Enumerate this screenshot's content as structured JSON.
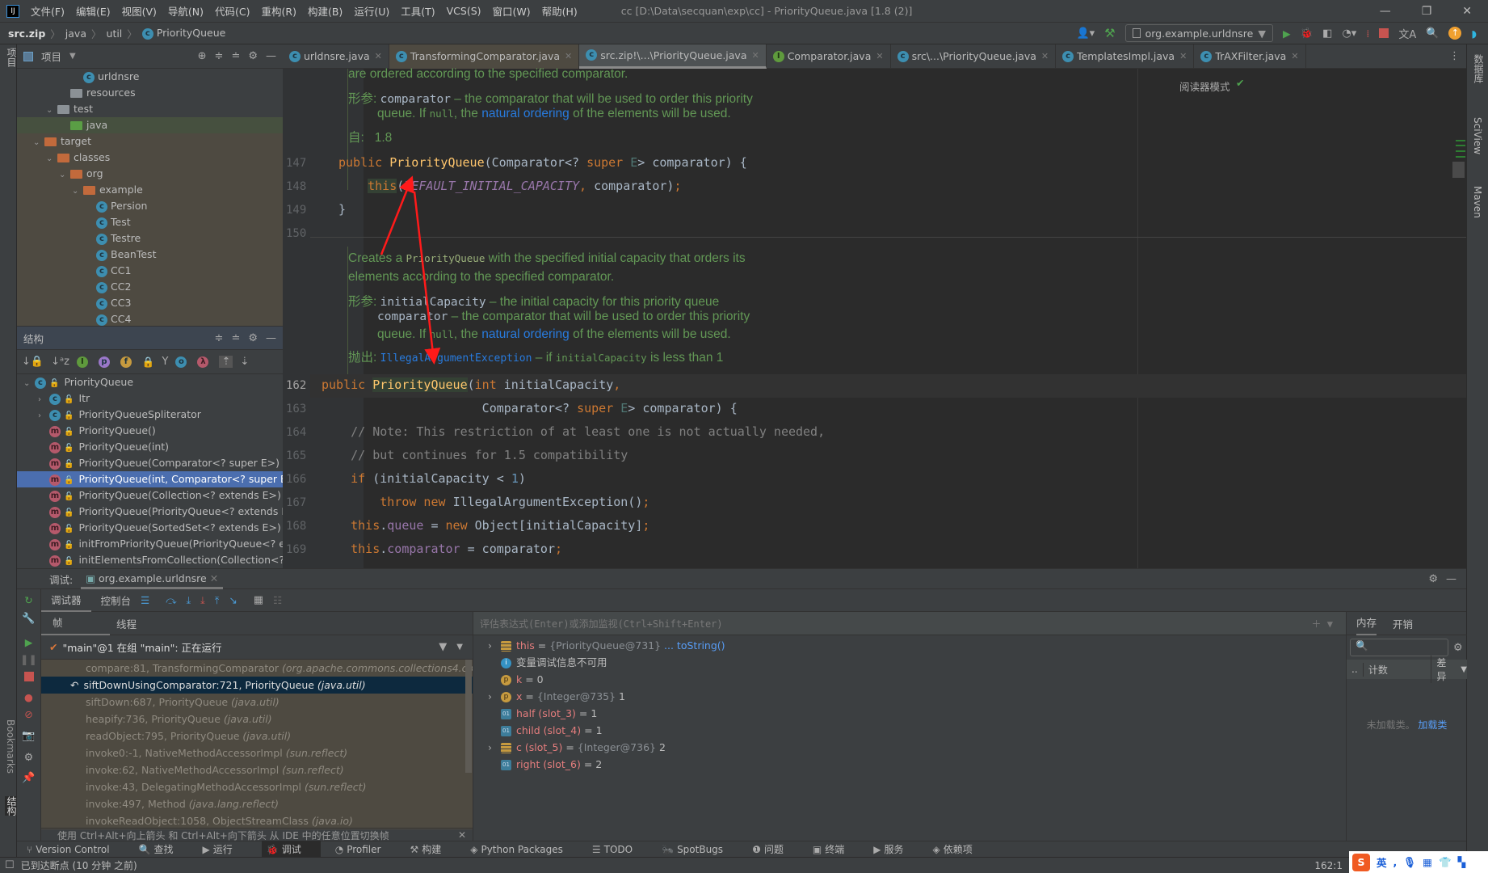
{
  "titlebar": {
    "menu": [
      "文件(F)",
      "编辑(E)",
      "视图(V)",
      "导航(N)",
      "代码(C)",
      "重构(R)",
      "构建(B)",
      "运行(U)",
      "工具(T)",
      "VCS(S)",
      "窗口(W)",
      "帮助(H)"
    ],
    "title": "cc [D:\\Data\\secquan\\exp\\cc] - PriorityQueue.java [1.8 (2)]"
  },
  "breadcrumb": [
    "src.zip",
    "java",
    "util",
    "PriorityQueue"
  ],
  "run_config": "org.example.urldnsre",
  "project": {
    "title": "项目",
    "items": [
      {
        "label": "urldnsre",
        "indent": 5,
        "icon": "class-run"
      },
      {
        "label": "resources",
        "indent": 4,
        "icon": "folder-resources"
      },
      {
        "label": "test",
        "indent": 3,
        "icon": "folder-grey",
        "open": true
      },
      {
        "label": "java",
        "indent": 4,
        "icon": "folder-green"
      },
      {
        "label": "target",
        "indent": 2,
        "icon": "folder-orange",
        "open": true
      },
      {
        "label": "classes",
        "indent": 3,
        "icon": "folder-orange",
        "open": true
      },
      {
        "label": "org",
        "indent": 4,
        "icon": "folder-orange",
        "open": true
      },
      {
        "label": "example",
        "indent": 5,
        "icon": "folder-orange",
        "open": true
      },
      {
        "label": "Persion",
        "indent": 6,
        "icon": "class"
      },
      {
        "label": "Test",
        "indent": 6,
        "icon": "class"
      },
      {
        "label": "Testre",
        "indent": 6,
        "icon": "class"
      },
      {
        "label": "BeanTest",
        "indent": 6,
        "icon": "class-run"
      },
      {
        "label": "CC1",
        "indent": 6,
        "icon": "class-run"
      },
      {
        "label": "CC2",
        "indent": 6,
        "icon": "class-run"
      },
      {
        "label": "CC3",
        "indent": 6,
        "icon": "class-run"
      },
      {
        "label": "CC4",
        "indent": 6,
        "icon": "class-run"
      }
    ]
  },
  "structure": {
    "title": "结构",
    "items": [
      {
        "label": "PriorityQueue",
        "icon": "c",
        "indent": 0,
        "chev": "v"
      },
      {
        "label": "Itr",
        "icon": "c",
        "indent": 1,
        "chev": ">"
      },
      {
        "label": "PriorityQueueSpliterator",
        "icon": "c",
        "indent": 1,
        "chev": ">"
      },
      {
        "label": "PriorityQueue()",
        "icon": "m",
        "indent": 1
      },
      {
        "label": "PriorityQueue(int)",
        "icon": "m",
        "indent": 1
      },
      {
        "label": "PriorityQueue(Comparator<? super E>)",
        "icon": "m",
        "indent": 1
      },
      {
        "label": "PriorityQueue(int, Comparator<? super E>)",
        "icon": "m",
        "indent": 1,
        "selected": true
      },
      {
        "label": "PriorityQueue(Collection<? extends E>)",
        "icon": "m",
        "indent": 1
      },
      {
        "label": "PriorityQueue(PriorityQueue<? extends E>)",
        "icon": "m",
        "indent": 1
      },
      {
        "label": "PriorityQueue(SortedSet<? extends E>)",
        "icon": "m",
        "indent": 1
      },
      {
        "label": "initFromPriorityQueue(PriorityQueue<? extends E>)",
        "icon": "m",
        "indent": 1,
        "private": true
      },
      {
        "label": "initElementsFromCollection(Collection<? extends E>)",
        "icon": "m",
        "indent": 1,
        "private": true
      }
    ]
  },
  "tabs": [
    {
      "label": "urldnsre.java",
      "icon": "c"
    },
    {
      "label": "TransformingComparator.java",
      "icon": "c"
    },
    {
      "label": "src.zip!\\...\\PriorityQueue.java",
      "icon": "c",
      "active": true
    },
    {
      "label": "Comparator.java",
      "icon": "i"
    },
    {
      "label": "src\\...\\PriorityQueue.java",
      "icon": "c"
    },
    {
      "label": "TemplatesImpl.java",
      "icon": "c"
    },
    {
      "label": "TrAXFilter.java",
      "icon": "c"
    }
  ],
  "reader_mode": "阅读器模式",
  "doc1": {
    "line0": "are ordered according to the specified comparator.",
    "param_label": "形参:",
    "param": "comparator",
    "param_desc": " – the comparator that will be used to order this priority",
    "line2a": "queue. If ",
    "null": "null",
    "line2b": ", the ",
    "link": "natural ordering",
    "line2c": " of the elements will be used.",
    "since_label": "自:",
    "since": "1.8"
  },
  "doc2": {
    "l1a": "Creates a ",
    "l1m": "PriorityQueue",
    "l1b": " with the specified initial capacity that orders its",
    "l2": "elements according to the specified comparator.",
    "param_label": "形参:",
    "p1": "initialCapacity",
    "p1d": " – the initial capacity for this priority queue",
    "p2": "comparator",
    "p2d": " – the comparator that will be used to order this priority",
    "l5a": "queue. If ",
    "null": "null",
    "l5b": ", the ",
    "link": "natural ordering",
    "l5c": " of the elements will be used.",
    "throws_label": "抛出:",
    "exc": "IllegalArgumentException",
    "td": " – if ",
    "tm": "initialCapacity",
    "te": " is less than 1"
  },
  "line_numbers": {
    "a": [
      "147",
      "148",
      "149",
      "150"
    ],
    "b": [
      "162",
      "163",
      "164",
      "165",
      "166",
      "167",
      "168",
      "169"
    ]
  },
  "debug": {
    "label": "调试:",
    "session": "org.example.urldnsre",
    "tab_debugger": "调试器",
    "tab_console": "控制台",
    "tab_frames": "帧",
    "tab_threads": "线程",
    "thread": "\"main\"@1 在组 \"main\": 正在运行",
    "frames": [
      {
        "m": "compare:81, TransformingComparator ",
        "p": "(org.apache.commons.collections4.comparators)"
      },
      {
        "m": "siftDownUsingComparator:721, PriorityQueue ",
        "p": "(java.util)",
        "current": true
      },
      {
        "m": "siftDown:687, PriorityQueue ",
        "p": "(java.util)"
      },
      {
        "m": "heapify:736, PriorityQueue ",
        "p": "(java.util)"
      },
      {
        "m": "readObject:795, PriorityQueue ",
        "p": "(java.util)"
      },
      {
        "m": "invoke0:-1, NativeMethodAccessorImpl ",
        "p": "(sun.reflect)"
      },
      {
        "m": "invoke:62, NativeMethodAccessorImpl ",
        "p": "(sun.reflect)"
      },
      {
        "m": "invoke:43, DelegatingMethodAccessorImpl ",
        "p": "(sun.reflect)"
      },
      {
        "m": "invoke:497, Method ",
        "p": "(java.lang.reflect)"
      },
      {
        "m": "invokeReadObject:1058, ObjectStreamClass ",
        "p": "(java.io)"
      }
    ],
    "hint": "使用 Ctrl+Alt+向上箭头 和 Ctrl+Alt+向下箭头 从 IDE 中的任意位置切换帧",
    "eval_placeholder": "评估表达式(Enter)或添加监视(Ctrl+Shift+Enter)",
    "vars": [
      {
        "name": "this",
        "eq": " = ",
        "type": "{PriorityQueue@731}",
        "extra": " ... toString()",
        "icon": "field",
        "exp": true
      },
      {
        "info": "变量调试信息不可用"
      },
      {
        "name": "k",
        "eq": " = ",
        "val": "0",
        "icon": "p"
      },
      {
        "name": "x",
        "eq": " = ",
        "type": "{Integer@735} ",
        "val": "1",
        "icon": "p",
        "exp": true
      },
      {
        "name": "half (slot_3)",
        "eq": " = ",
        "val": "1",
        "icon": "01"
      },
      {
        "name": "child (slot_4)",
        "eq": " = ",
        "val": "1",
        "icon": "01"
      },
      {
        "name": "c (slot_5)",
        "eq": " = ",
        "type": "{Integer@736} ",
        "val": "2",
        "icon": "field",
        "exp": true
      },
      {
        "name": "right (slot_6)",
        "eq": " = ",
        "val": "2",
        "icon": "01"
      }
    ],
    "memory_tab": "内存",
    "overhead_tab": "开销",
    "col_count": "计数",
    "col_diff": "差异",
    "no_classes": "未加载类。",
    "load_classes": "加载类"
  },
  "bottom_tools": [
    "Version Control",
    "查找",
    "运行",
    "调试",
    "Profiler",
    "构建",
    "Python Packages",
    "TODO",
    "SpotBugs",
    "问题",
    "终端",
    "服务",
    "依赖项"
  ],
  "status": {
    "message": "已到达断点 (10 分钟 之前)",
    "position": "162:1"
  },
  "right_tools": [
    "数据库",
    "SciView",
    "Maven"
  ],
  "left_tools": [
    "项目",
    "Bookmarks",
    "结构"
  ],
  "colors": {
    "accent": "#4b6eaf",
    "annotation_arrow": "#ff1a1a"
  }
}
